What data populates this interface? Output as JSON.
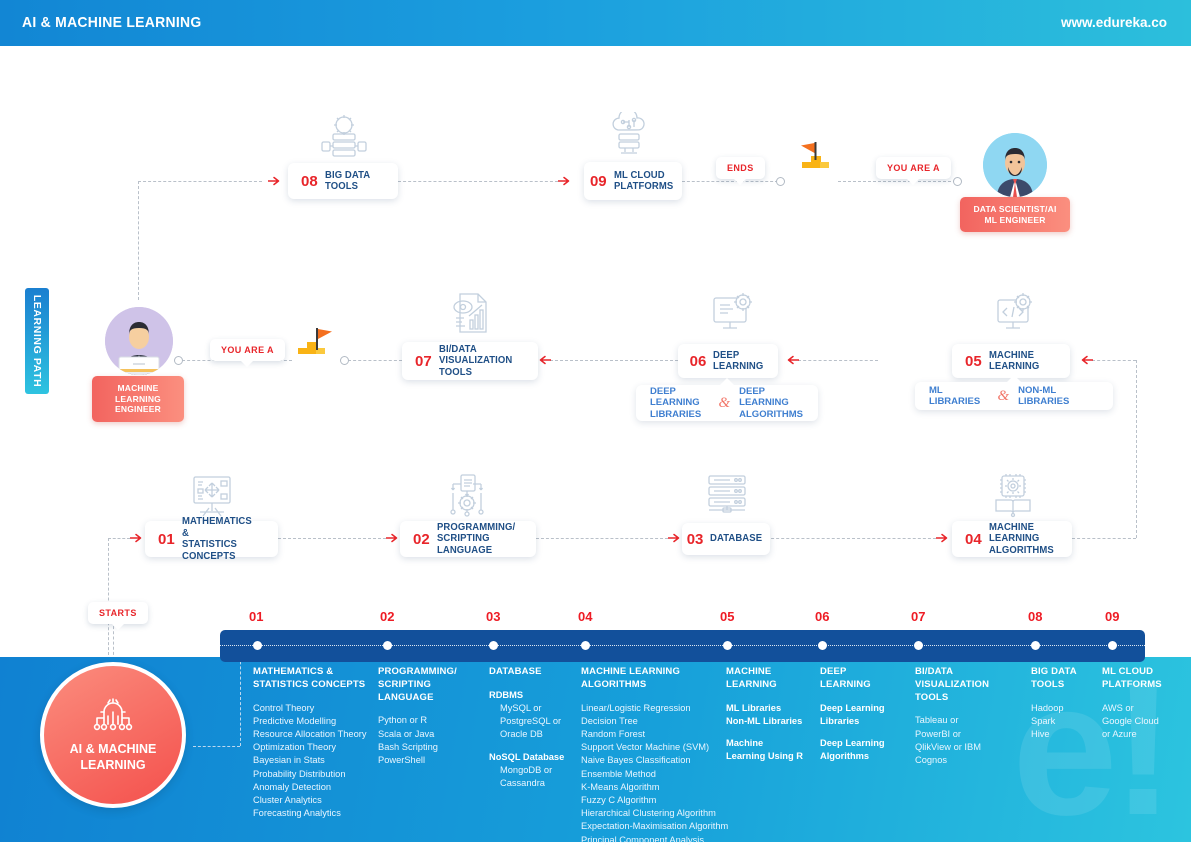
{
  "header": {
    "title": "AI & MACHINE LEARNING",
    "url": "www.edureka.co"
  },
  "sidebar_tab": {
    "label": "LEARNING PATH"
  },
  "markers": {
    "starts": "STARTS",
    "ends": "ENDS",
    "you_are_a_mid": "YOU ARE A",
    "you_are_a_top": "YOU ARE A"
  },
  "roles": {
    "ml_engineer": "MACHINE LEARNING ENGINEER",
    "data_scientist": "DATA SCIENTIST/AI ML ENGINEER"
  },
  "center_node": {
    "title": "AI & MACHINE LEARNING",
    "icon": "ai-chip-gear-icon"
  },
  "steps": [
    {
      "num": "01",
      "label": "MATHEMATICS &\nSTATISTICS CONCEPTS",
      "icon": "easel-chart-icon"
    },
    {
      "num": "02",
      "label": "PROGRAMMING/\nSCRIPTING LANGUAGE",
      "icon": "code-flow-gear-icon"
    },
    {
      "num": "03",
      "label": "DATABASE",
      "icon": "database-server-icon"
    },
    {
      "num": "04",
      "label": "MACHINE LEARNING\nALGORITHMS",
      "icon": "book-chip-icon"
    },
    {
      "num": "05",
      "label": "MACHINE LEARNING",
      "icon": "monitor-gear-icon"
    },
    {
      "num": "06",
      "label": "DEEP LEARNING",
      "icon": "monitor-neural-gear-icon"
    },
    {
      "num": "07",
      "label": "BI/DATA\nVISUALIZATION TOOLS",
      "icon": "report-eye-chart-icon"
    },
    {
      "num": "08",
      "label": "BIG DATA TOOLS",
      "icon": "server-gear-icon"
    },
    {
      "num": "09",
      "label": "ML CLOUD\nPLATFORMS",
      "icon": "cloud-server-icon"
    }
  ],
  "sub_pills": {
    "deep_learning": {
      "left": "DEEP LEARNING LIBRARIES",
      "amp": "&",
      "right": "DEEP LEARNING ALGORITHMS"
    },
    "machine_learning": {
      "left": "ML LIBRARIES",
      "amp": "&",
      "right": "NON-ML LIBRARIES"
    }
  },
  "timeline": {
    "numbers": [
      "01",
      "02",
      "03",
      "04",
      "05",
      "06",
      "07",
      "08",
      "09"
    ],
    "columns": [
      {
        "num": "01",
        "title": "MATHEMATICS &\nSTATISTICS CONCEPTS",
        "items": [
          {
            "text": "Control Theory"
          },
          {
            "text": "Predictive Modelling"
          },
          {
            "text": "Resource Allocation Theory"
          },
          {
            "text": "Optimization Theory"
          },
          {
            "text": "Bayesian in Stats"
          },
          {
            "text": "Probability Distribution"
          },
          {
            "text": "Anomaly Detection"
          },
          {
            "text": "Cluster Analytics"
          },
          {
            "text": "Forecasting Analytics"
          }
        ]
      },
      {
        "num": "02",
        "title": "PROGRAMMING/\nSCRIPTING LANGUAGE",
        "items": [
          {
            "text": "Python or R"
          },
          {
            "text": "Scala or Java"
          },
          {
            "text": "Bash Scripting"
          },
          {
            "text": "PowerShell"
          }
        ]
      },
      {
        "num": "03",
        "title": "DATABASE",
        "items": [
          {
            "text": "RDBMS",
            "style": "bold"
          },
          {
            "text": "MySQL or",
            "style": "ind"
          },
          {
            "text": "PostgreSQL or",
            "style": "ind"
          },
          {
            "text": "Oracle DB",
            "style": "ind"
          },
          {
            "text": "",
            "style": "gap"
          },
          {
            "text": "NoSQL Database",
            "style": "bold"
          },
          {
            "text": "MongoDB or",
            "style": "ind"
          },
          {
            "text": "Cassandra",
            "style": "ind"
          }
        ]
      },
      {
        "num": "04",
        "title": "MACHINE LEARNING\nALGORITHMS",
        "items": [
          {
            "text": "Linear/Logistic Regression"
          },
          {
            "text": "Decision Tree"
          },
          {
            "text": "Random Forest"
          },
          {
            "text": "Support Vector Machine (SVM)"
          },
          {
            "text": "Naive Bayes Classification"
          },
          {
            "text": "Ensemble Method"
          },
          {
            "text": "K-Means Algorithm"
          },
          {
            "text": "Fuzzy C Algorithm"
          },
          {
            "text": "Hierarchical Clustering Algorithm"
          },
          {
            "text": "Expectation-Maximisation Algorithm"
          },
          {
            "text": "Principal Component Analysis"
          }
        ]
      },
      {
        "num": "05",
        "title": "MACHINE\nLEARNING",
        "items": [
          {
            "text": "ML Libraries",
            "style": "bold"
          },
          {
            "text": "Non-ML Libraries",
            "style": "bold"
          },
          {
            "text": "",
            "style": "gap"
          },
          {
            "text": "Machine",
            "style": "bold"
          },
          {
            "text": "Learning Using R",
            "style": "bold"
          }
        ]
      },
      {
        "num": "06",
        "title": "DEEP\nLEARNING",
        "items": [
          {
            "text": "Deep Learning",
            "style": "bold"
          },
          {
            "text": "Libraries",
            "style": "bold"
          },
          {
            "text": "",
            "style": "gap"
          },
          {
            "text": "Deep Learning",
            "style": "bold"
          },
          {
            "text": "Algorithms",
            "style": "bold"
          }
        ]
      },
      {
        "num": "07",
        "title": "BI/DATA\nVISUALIZATION TOOLS",
        "items": [
          {
            "text": "Tableau or"
          },
          {
            "text": "PowerBI or"
          },
          {
            "text": "QlikView or IBM"
          },
          {
            "text": "Cognos"
          }
        ]
      },
      {
        "num": "08",
        "title": "BIG DATA\nTOOLS",
        "items": [
          {
            "text": "Hadoop"
          },
          {
            "text": "Spark"
          },
          {
            "text": "Hive"
          }
        ]
      },
      {
        "num": "09",
        "title": "ML CLOUD\nPLATFORMS",
        "items": [
          {
            "text": "AWS or"
          },
          {
            "text": "Google Cloud"
          },
          {
            "text": "or Azure"
          }
        ]
      }
    ]
  },
  "colors": {
    "accent_red": "#e8252a",
    "step_blue": "#1f4f86",
    "panel_blue": "#1081d2",
    "panel_cyan": "#2cc4df",
    "dark_bar": "#12509b",
    "coral": "#f4504c",
    "flag_yellow": "#f9b315",
    "flag_orange": "#f4701f"
  },
  "watermark": {
    "text": "e!"
  }
}
